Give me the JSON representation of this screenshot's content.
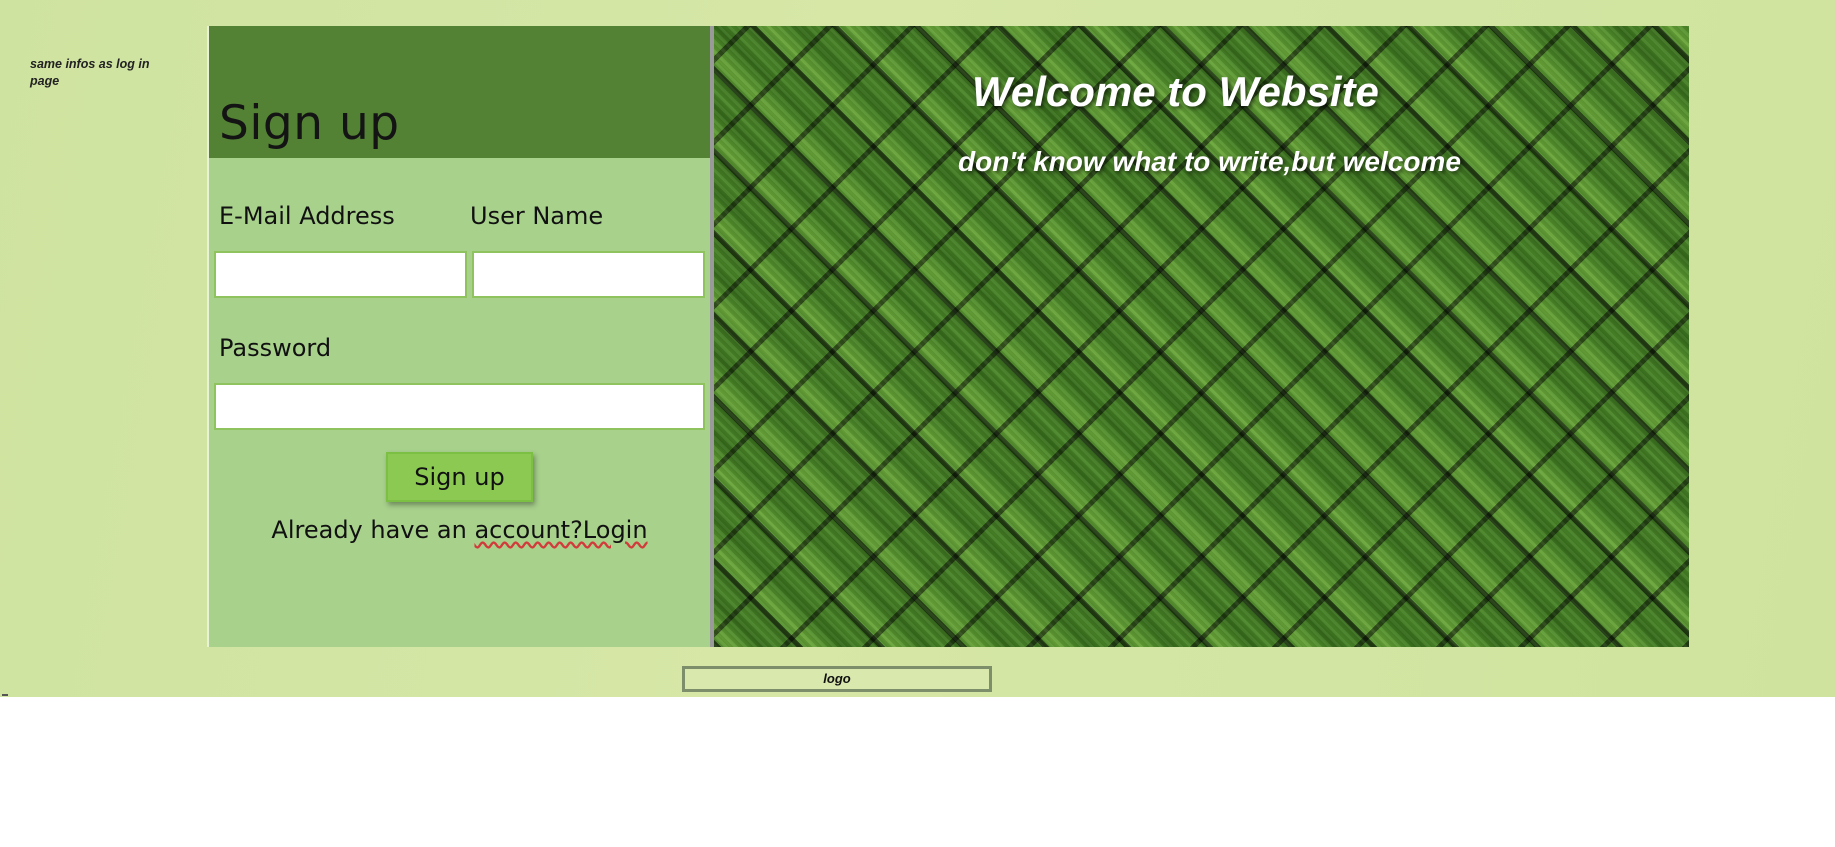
{
  "note": {
    "line1": "same infos as log in",
    "line2": "page"
  },
  "form": {
    "title": "Sign up",
    "email_label": "E-Mail Address",
    "email_value": "",
    "username_label": "User Name",
    "username_value": "",
    "password_label": "Password",
    "password_value": "",
    "submit_label": "Sign up",
    "footer_text": "Already have an ",
    "footer_link": "account?Login"
  },
  "hero": {
    "title": "Welcome to Website",
    "subtitle": "don't know what to write,but welcome"
  },
  "footer": {
    "logo_label": "logo"
  },
  "colors": {
    "page_bg": "#d6e7a6",
    "form_bg": "#a8d18c",
    "header_bg": "#548235",
    "button_bg": "#8cc953",
    "input_border": "#8fc35e"
  }
}
